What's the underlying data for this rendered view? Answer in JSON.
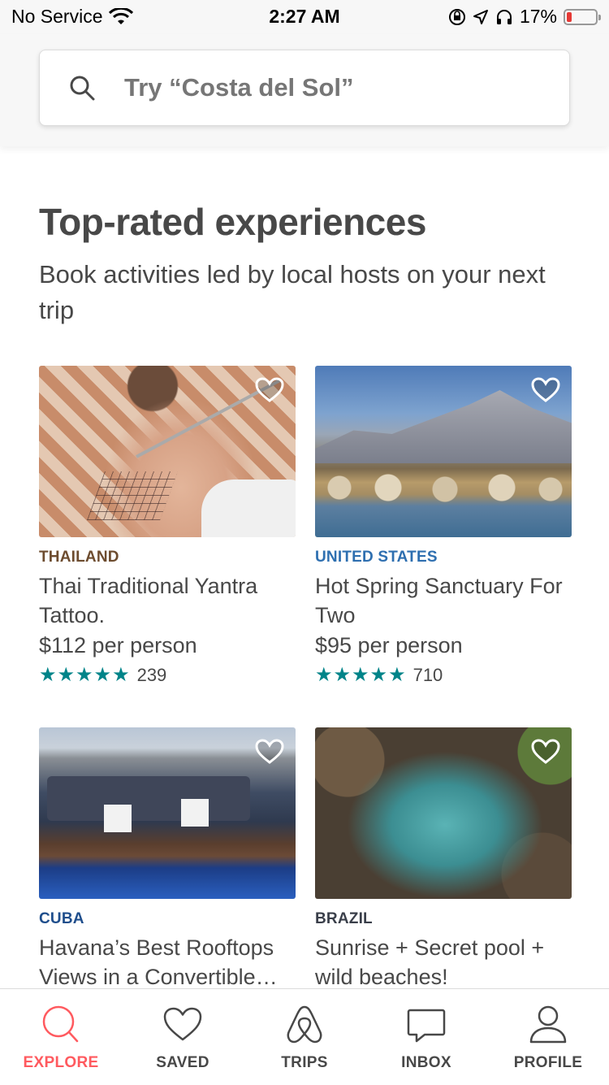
{
  "status_bar": {
    "carrier": "No Service",
    "time": "2:27 AM",
    "battery": "17%",
    "battery_level": 0.17,
    "icons": [
      "wifi-icon",
      "rotation-lock-icon",
      "location-icon",
      "headphones-icon",
      "battery-icon"
    ]
  },
  "search": {
    "placeholder": "Try “Costa del Sol”",
    "icon": "search-icon"
  },
  "section": {
    "title": "Top-rated experiences",
    "subtitle": "Book activities led by local hosts on your next trip"
  },
  "cards": [
    {
      "country": "THAILAND",
      "country_color": "#6d4c2f",
      "title": "Thai Traditional Yantra Tattoo.",
      "price": "$112 per person",
      "stars": "★★★★★",
      "reviews": "239"
    },
    {
      "country": "UNITED STATES",
      "country_color": "#2e6fb0",
      "title": "Hot Spring Sanctuary For Two",
      "price": "$95 per person",
      "stars": "★★★★★",
      "reviews": "710"
    },
    {
      "country": "CUBA",
      "country_color": "#1f4e8c",
      "title": "Havana’s Best Rooftops Views in a Convertible…",
      "price": "",
      "stars": "",
      "reviews": ""
    },
    {
      "country": "BRAZIL",
      "country_color": "#3a3f4a",
      "title": "Sunrise + Secret pool + wild beaches!",
      "price": "",
      "stars": "",
      "reviews": ""
    }
  ],
  "nav": {
    "items": [
      {
        "label": "EXPLORE",
        "icon": "search-icon",
        "active": true
      },
      {
        "label": "SAVED",
        "icon": "heart-icon",
        "active": false
      },
      {
        "label": "TRIPS",
        "icon": "airbnb-logo-icon",
        "active": false
      },
      {
        "label": "INBOX",
        "icon": "message-icon",
        "active": false
      },
      {
        "label": "PROFILE",
        "icon": "user-icon",
        "active": false
      }
    ]
  },
  "colors": {
    "accent": "#ff5a5f",
    "rating": "#008489",
    "text": "#484848"
  }
}
